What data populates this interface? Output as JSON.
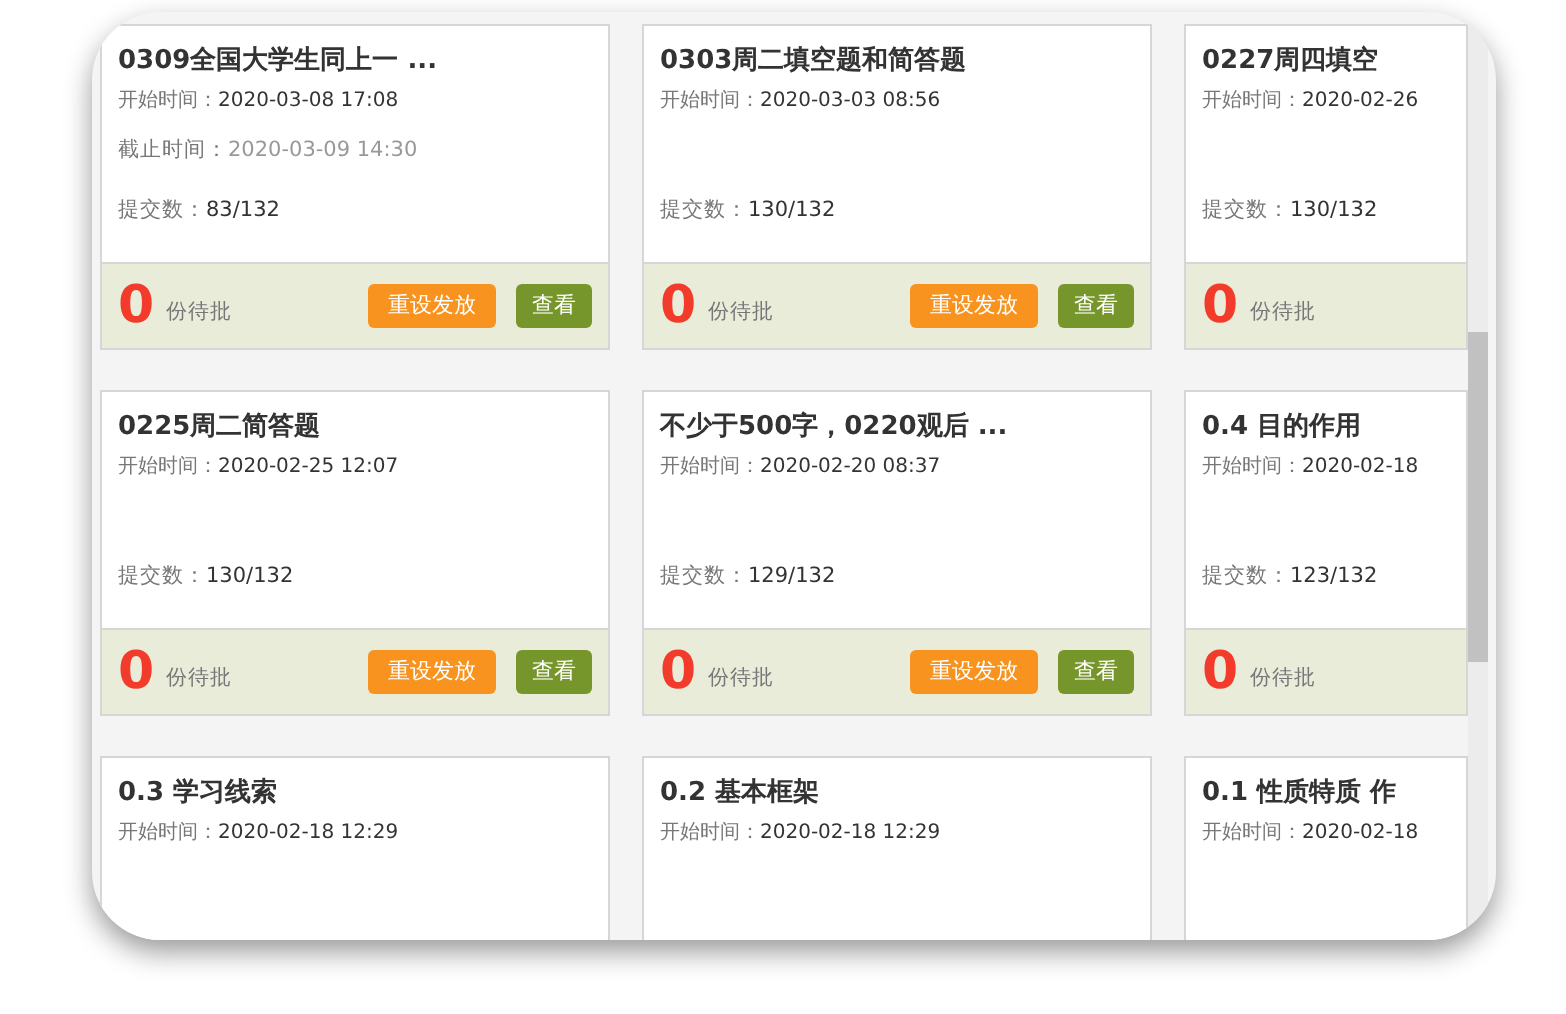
{
  "cards": [
    {
      "title": "0309全国大学生同上一 ...",
      "start_label": "开始时间：",
      "start": "2020-03-08 17:08",
      "deadline_label": "截止时间：",
      "deadline": "2020-03-09 14:30",
      "submitted_label": "提交数：",
      "submitted": "83/132",
      "pending_count": "0",
      "pending_label": "份待批",
      "buttons": [
        {
          "label": "重设发放",
          "kind": "reset"
        },
        {
          "label": "查看",
          "kind": "view"
        }
      ]
    },
    {
      "title": "0303周二填空题和简答题",
      "start_label": "开始时间：",
      "start": "2020-03-03 08:56",
      "submitted_label": "提交数：",
      "submitted": "130/132",
      "pending_count": "0",
      "pending_label": "份待批",
      "buttons": [
        {
          "label": "重设发放",
          "kind": "reset"
        },
        {
          "label": "查看",
          "kind": "view"
        }
      ]
    },
    {
      "title": "0227周四填空",
      "start_label": "开始时间：",
      "start": "2020-02-26",
      "submitted_label": "提交数：",
      "submitted": "130/132",
      "pending_count": "0",
      "pending_label": "份待批"
    },
    {
      "title": "0225周二简答题",
      "start_label": "开始时间：",
      "start": "2020-02-25 12:07",
      "submitted_label": "提交数：",
      "submitted": "130/132",
      "pending_count": "0",
      "pending_label": "份待批",
      "buttons": [
        {
          "label": "重设发放",
          "kind": "reset"
        },
        {
          "label": "查看",
          "kind": "view"
        }
      ]
    },
    {
      "title": "不少于500字，0220观后 ...",
      "start_label": "开始时间：",
      "start": "2020-02-20 08:37",
      "submitted_label": "提交数：",
      "submitted": "129/132",
      "pending_count": "0",
      "pending_label": "份待批",
      "buttons": [
        {
          "label": "重设发放",
          "kind": "reset"
        },
        {
          "label": "查看",
          "kind": "view"
        }
      ]
    },
    {
      "title": "0.4 目的作用",
      "start_label": "开始时间：",
      "start": "2020-02-18",
      "submitted_label": "提交数：",
      "submitted": "123/132",
      "pending_count": "0",
      "pending_label": "份待批"
    },
    {
      "title": "0.3 学习线索",
      "start_label": "开始时间：",
      "start": "2020-02-18 12:29"
    },
    {
      "title": "0.2 基本框架",
      "start_label": "开始时间：",
      "start": "2020-02-18 12:29"
    },
    {
      "title": "0.1 性质特质 作",
      "start_label": "开始时间：",
      "start": "2020-02-18"
    }
  ]
}
